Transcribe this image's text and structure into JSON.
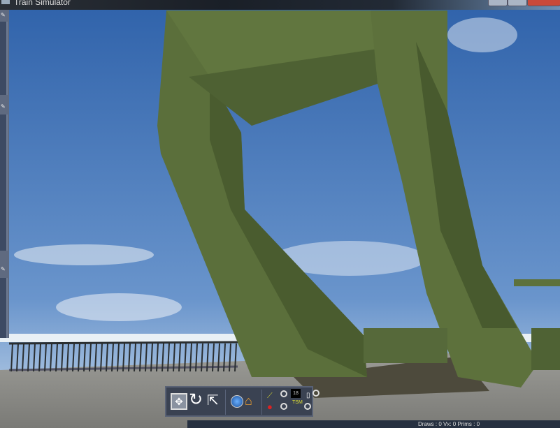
{
  "window": {
    "title": "Train Simulator"
  },
  "toolbar": {
    "buttons": [
      {
        "name": "move-mode",
        "icon": "move-arrows-icon"
      },
      {
        "name": "rotate",
        "icon": "rotate-icon"
      },
      {
        "name": "scale",
        "icon": "scale-icon"
      },
      {
        "name": "world",
        "icon": "globe-icon"
      },
      {
        "name": "home",
        "icon": "home-icon"
      }
    ],
    "counter_value": "18",
    "small_label": "TSM"
  },
  "status": {
    "text": "Draws : 0 Vx: 0 Prims : 0"
  },
  "colors": {
    "sky": "#3f73b8",
    "steel": "#5a6e3a",
    "toolbar": "#3a4252"
  }
}
